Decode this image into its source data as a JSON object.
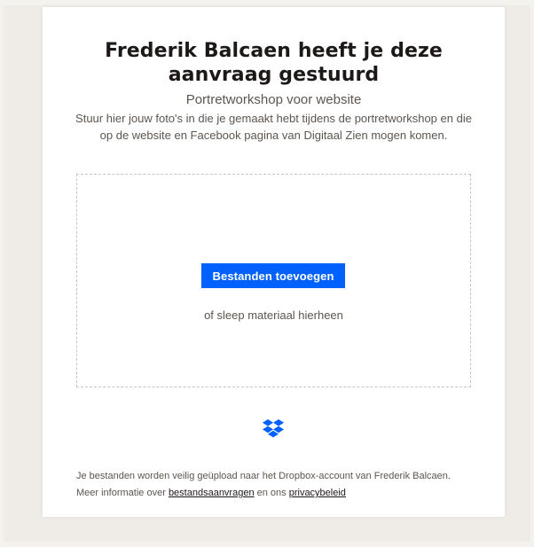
{
  "request": {
    "title": "Frederik Balcaen heeft je deze aanvraag gestuurd",
    "name": "Portretworkshop voor website",
    "description": "Stuur hier jouw foto's in die je gemaakt hebt tijdens de portretworkshop en die op de website en Facebook pagina van Digitaal Zien mogen komen."
  },
  "upload": {
    "add_files_label": "Bestanden toevoegen",
    "drop_hint": "of sleep materiaal hierheen"
  },
  "brand": {
    "logo_icon": "dropbox-icon",
    "accent_color": "#0061fe"
  },
  "footer": {
    "text_before": "Je bestanden worden veilig geüpload naar het Dropbox-account van Frederik Balcaen. Meer informatie over ",
    "link_requests": "bestandsaanvragen",
    "text_middle": " en ons ",
    "link_privacy": "privacybeleid"
  }
}
